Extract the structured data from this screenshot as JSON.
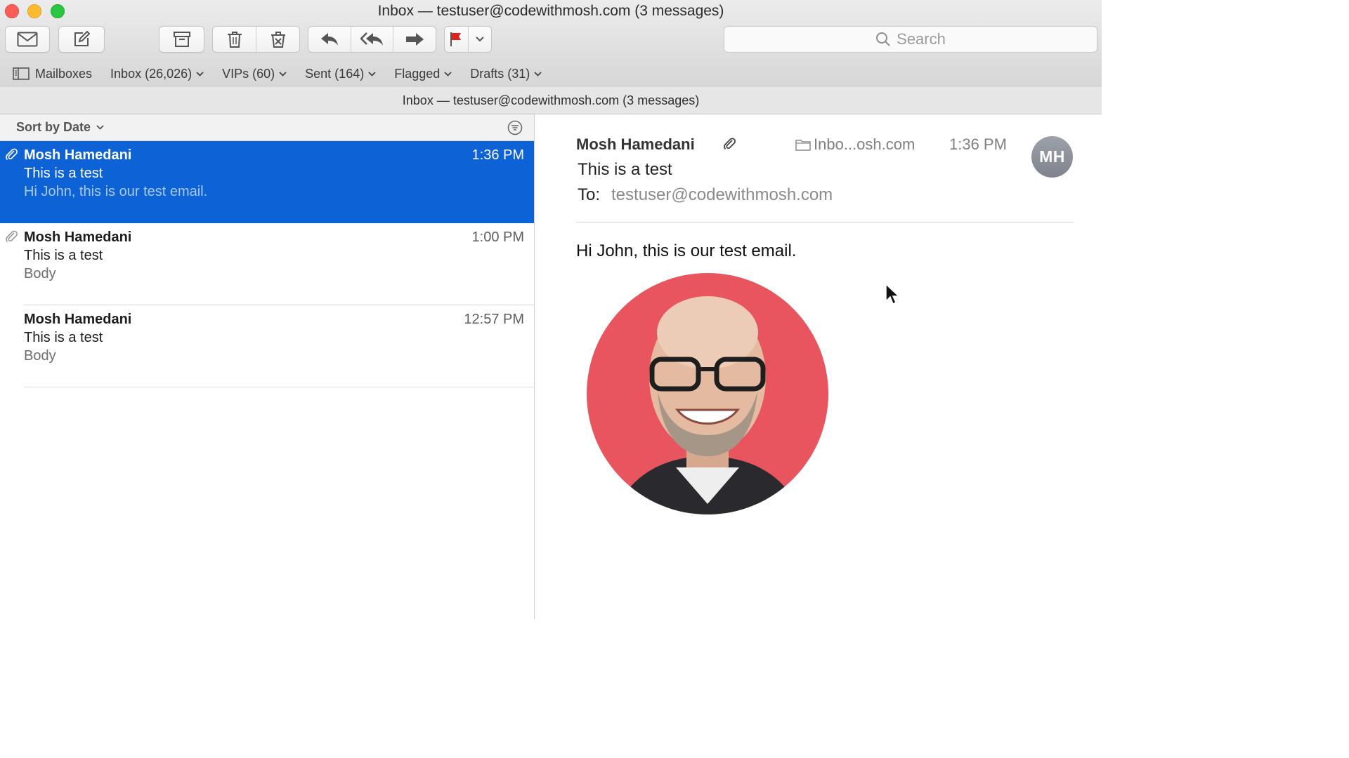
{
  "window": {
    "title": "Inbox — testuser@codewithmosh.com (3 messages)"
  },
  "toolbar": {
    "icons": [
      "get-mail-icon",
      "compose-icon",
      "archive-icon",
      "trash-icon",
      "junk-icon",
      "reply-icon",
      "reply-all-icon",
      "forward-icon",
      "flag-icon",
      "chevron-down-icon"
    ],
    "search_placeholder": "Search",
    "flag_color": "#e0201b"
  },
  "favorites": {
    "mailboxes": "Mailboxes",
    "items": [
      "Inbox (26,026)",
      "VIPs (60)",
      "Sent (164)",
      "Flagged",
      "Drafts (31)"
    ]
  },
  "subtitle": "Inbox — testuser@codewithmosh.com (3 messages)",
  "list": {
    "sort_label": "Sort by Date",
    "selected_color": "#0d63d6",
    "messages": [
      {
        "sender": "Mosh Hamedani",
        "time": "1:36 PM",
        "subject": "This is a test",
        "preview": "Hi John, this is our test email."
      },
      {
        "sender": "Mosh Hamedani",
        "time": "1:00 PM",
        "subject": "This is a test",
        "preview": "Body"
      },
      {
        "sender": "Mosh Hamedani",
        "time": "12:57 PM",
        "subject": "This is a test",
        "preview": "Body"
      }
    ]
  },
  "reader": {
    "from": "Mosh Hamedani",
    "mailbox": "Inbo...osh.com",
    "time": "1:36 PM",
    "avatar_initials": "MH",
    "subject": "This is a test",
    "to_label": "To:",
    "to_address": "testuser@codewithmosh.com",
    "body": "Hi John, this is our test email.",
    "photo_bg": "#e9555e"
  }
}
